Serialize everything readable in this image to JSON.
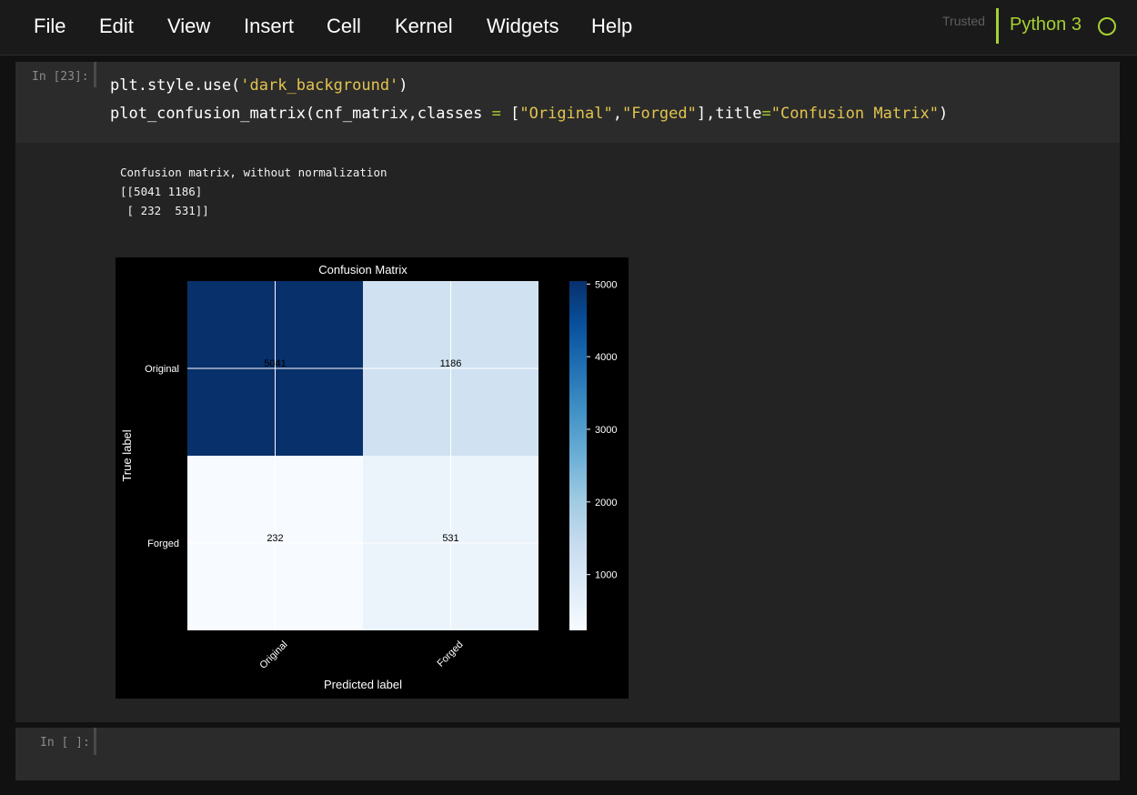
{
  "menubar": {
    "items": [
      "File",
      "Edit",
      "View",
      "Insert",
      "Cell",
      "Kernel",
      "Widgets",
      "Help"
    ],
    "trusted_label": "Trusted",
    "kernel_name": "Python 3"
  },
  "cells": {
    "code": {
      "prompt": "In [23]:",
      "line1": {
        "a": "plt.style.use(",
        "b": "'dark_background'",
        "c": ")"
      },
      "line2": {
        "a": "plot_confusion_matrix(cnf_matrix,classes ",
        "b": "=",
        "c": " [",
        "d": "\"Original\"",
        "e": ",",
        "f": "\"Forged\"",
        "g": "],title",
        "h": "=",
        "i": "\"Confusion Matrix\"",
        "j": ")"
      },
      "output_text": "Confusion matrix, without normalization\n[[5041 1186]\n [ 232  531]]"
    },
    "empty": {
      "prompt": "In [ ]:"
    }
  },
  "colors": {
    "accent": "#a6d131",
    "string": "#e2c44e",
    "cmap_low": "#f7fbff",
    "cmap_high": "#08306b"
  },
  "chart_data": {
    "type": "heatmap",
    "title": "Confusion Matrix",
    "xlabel": "Predicted label",
    "ylabel": "True label",
    "x_categories": [
      "Original",
      "Forged"
    ],
    "y_categories": [
      "Original",
      "Forged"
    ],
    "values": [
      [
        5041,
        1186
      ],
      [
        232,
        531
      ]
    ],
    "colormap": "Blues",
    "colorbar_range": [
      232,
      5041
    ],
    "colorbar_ticks": [
      1000,
      2000,
      3000,
      4000,
      5000
    ],
    "grid": true
  }
}
